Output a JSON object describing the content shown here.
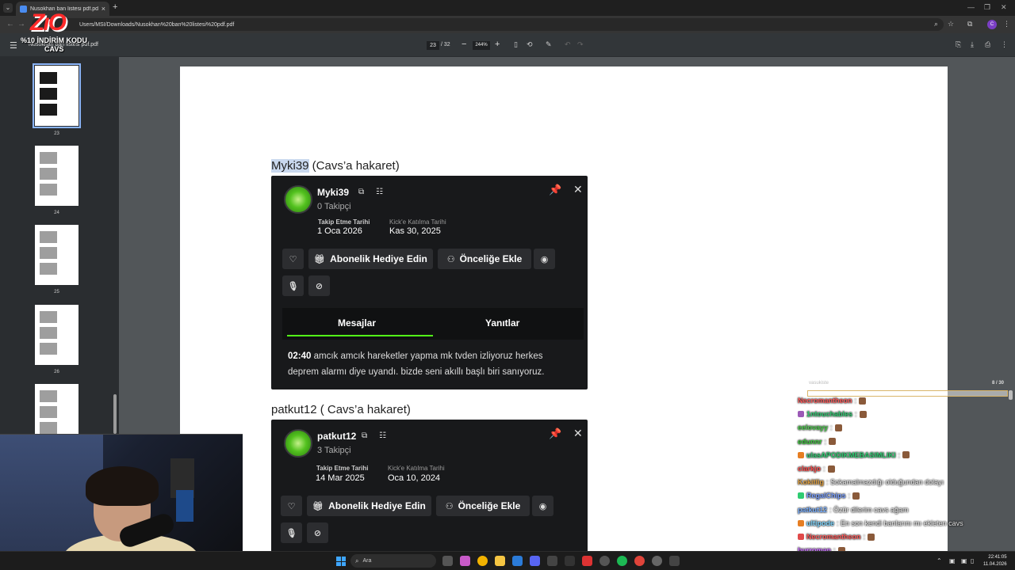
{
  "browser": {
    "tab_title": "Nusokhan ban listesi pdf.pdf",
    "tab_close": "×",
    "new_tab": "+",
    "url": "Users/MSI/Downloads/Nusokhan%20ban%20listesi%20pdf.pdf",
    "back": "←",
    "forward": "→",
    "reload": "⟳"
  },
  "pdf_toolbar": {
    "title": "Nusokhan ban listesi pdf.pdf",
    "current_page": "23",
    "total_pages": "/ 32",
    "zoom_out": "−",
    "zoom": "244%",
    "zoom_in": "+"
  },
  "sidebar": {
    "thumbnails": [
      {
        "num": "23"
      },
      {
        "num": "24"
      },
      {
        "num": "25"
      },
      {
        "num": "26"
      }
    ]
  },
  "logo": {
    "big": "ZıO",
    "line1": "%10 İNDİRİM KODU",
    "line2": "CAVS"
  },
  "document": {
    "entry1": {
      "heading_name": "Myki39",
      "heading_reason": " (Cavs’a hakaret)",
      "username": "Myki39",
      "followers": "0 Takipçi",
      "follow_date_label": "Takip Etme Tarihi",
      "follow_date": "1 Oca 2026",
      "join_date_label": "Kick'e Katılma Tarihi",
      "join_date": "Kas 30, 2025",
      "gift_button": "Abonelik Hediye Edin",
      "priority_button": "Önceliğe Ekle",
      "tab_messages": "Mesajlar",
      "tab_replies": "Yanıtlar",
      "message_time": "02:40",
      "message_text": " amcık amcık hareketler yapma mk tvden izliyoruz herkes deprem alarmı diye uyandı. bizde seni akıllı başlı biri sanıyoruz."
    },
    "entry2": {
      "heading": "patkut12 ( Cavs’a hakaret)",
      "username": "patkut12",
      "followers": "3 Takipçi",
      "follow_date_label": "Takip Etme Tarihi",
      "follow_date": "14 Mar 2025",
      "join_date_label": "Kick'e Katılma Tarihi",
      "join_date": "Oca 10, 2024",
      "gift_button": "Abonelik Hediye Edin",
      "priority_button": "Önceliğe Ekle"
    }
  },
  "chat": {
    "meta": "vasukiste",
    "count": "8 / 30",
    "lines": [
      {
        "user": "Necromantheon",
        "text": ":",
        "color": "#ff5a5a"
      },
      {
        "user": "1ntouchables",
        "text": ":",
        "color": "#2ecc71"
      },
      {
        "user": "eelovayy",
        "text": ":",
        "color": "#4fd14f"
      },
      {
        "user": "edunnr",
        "text": ":",
        "color": "#3cc83c"
      },
      {
        "user": "ulasAPODIKMEBASIMLIKI",
        "text": ":",
        "color": "#2ecc71"
      },
      {
        "user": "clarkjo",
        "text": ":",
        "color": "#ff4d4d"
      },
      {
        "user": "Kokitlig",
        "text": ": Sokamalmazdığı olduğundan dolayı",
        "color": "#e0a040"
      },
      {
        "user": "RegalChips",
        "text": ":",
        "color": "#7aa0ff"
      },
      {
        "user": "patkut12",
        "text": ": Özür dilerim cavs ağam",
        "color": "#7ab0ff"
      },
      {
        "user": "ultipode",
        "text": ": En son kendi banlarını mı ekleten cavs",
        "color": "#7fd7ff"
      },
      {
        "user": "Necromantheon",
        "text": ":",
        "color": "#ff5a5a"
      },
      {
        "user": "burroman",
        "text": ":",
        "color": "#c86aff"
      }
    ]
  },
  "taskbar": {
    "search_placeholder": "Ara",
    "time": "22:41:05",
    "date": "11.04.2026"
  },
  "colors": {
    "kick_green": "#53fc18",
    "card_bg": "#18191b",
    "highlight": "#c9d8ee"
  }
}
